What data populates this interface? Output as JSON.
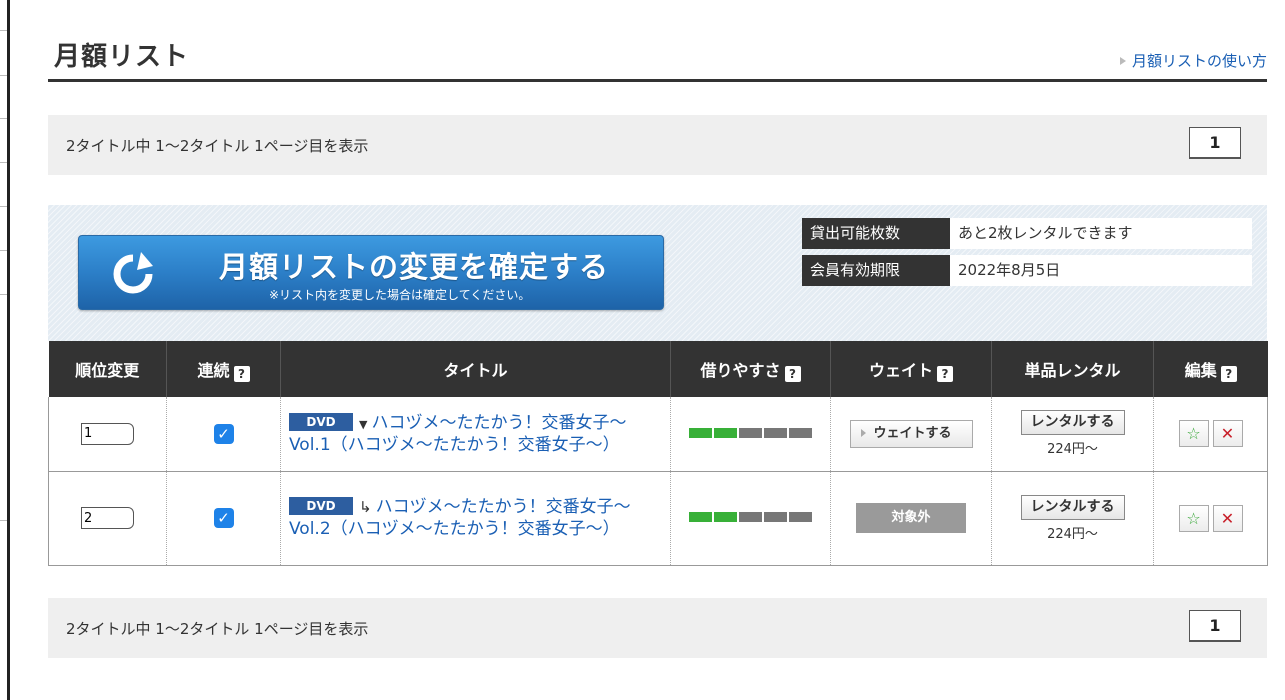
{
  "header": {
    "title": "月額リスト",
    "help_link": "月額リストの使い方"
  },
  "pager": {
    "summary": "2タイトル中 1〜2タイトル 1ページ目を表示",
    "current_page": "1"
  },
  "confirm": {
    "label": "月額リストの変更を確定する",
    "note": "※リスト内を変更した場合は確定してください。"
  },
  "info": {
    "rows": [
      {
        "label": "貸出可能枚数",
        "value": "あと2枚レンタルできます"
      },
      {
        "label": "会員有効期限",
        "value": "2022年8月5日"
      }
    ]
  },
  "table": {
    "headers": [
      "順位変更",
      "連続",
      "タイトル",
      "借りやすさ",
      "ウェイト",
      "単品レンタル",
      "編集"
    ],
    "help_icon": "?",
    "rows": [
      {
        "rank": "1",
        "continuous": true,
        "badge": "DVD",
        "title": "ハコヅメ〜たたかう！交番女子〜 Vol.1（ハコヅメ〜たたかう！交番女子〜）",
        "title_icon": "triangle-down-icon",
        "availability_level": 2,
        "availability_max": 5,
        "wait_label": "ウェイトする",
        "rent_label": "レンタルする",
        "price": "224円〜"
      },
      {
        "rank": "2",
        "continuous": true,
        "badge": "DVD",
        "title": "ハコヅメ〜たたかう！交番女子〜 Vol.2（ハコヅメ〜たたかう！交番女子〜）",
        "title_icon": "subdirectory-arrow-icon",
        "availability_level": 2,
        "availability_max": 5,
        "wait_label": "対象外",
        "rent_label": "レンタルする",
        "price": "224円〜"
      }
    ]
  },
  "colors": {
    "header_bg": "#333333",
    "accent_blue": "#2c7fc8",
    "link": "#1a5fb4",
    "availability_on": "#38b038",
    "availability_off": "#777777"
  }
}
